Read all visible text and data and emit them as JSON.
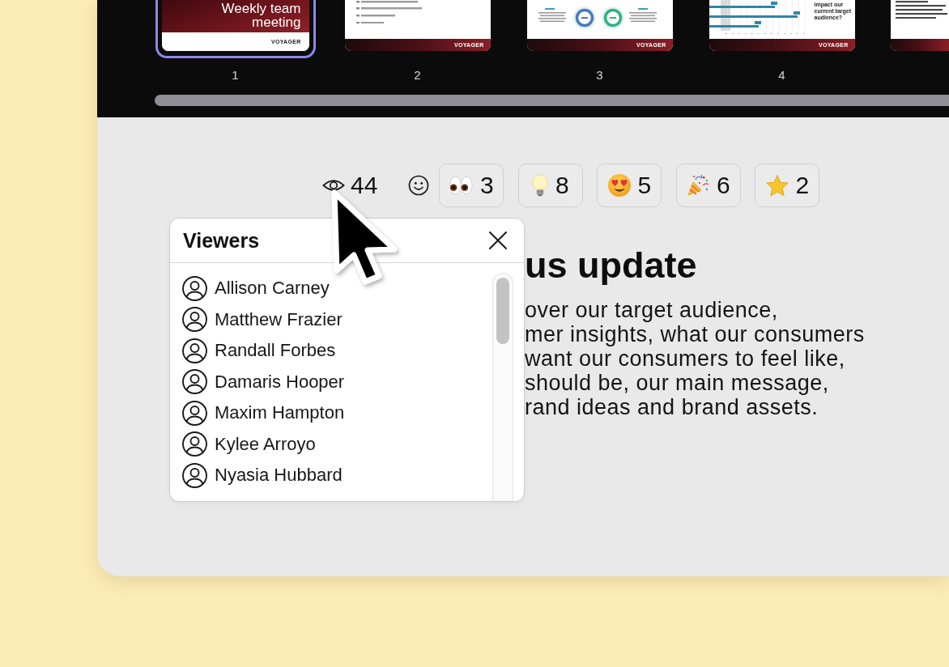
{
  "filmstrip": {
    "slides": [
      {
        "kind": "title",
        "title": "Weekly team meeting",
        "logo": "VOYAGER",
        "number": "1",
        "selected": true
      },
      {
        "kind": "agenda",
        "logo": "VOYAGER",
        "number": "2",
        "selected": false
      },
      {
        "kind": "donuts",
        "logo": "VOYAGER",
        "number": "3",
        "selected": false
      },
      {
        "kind": "bars",
        "question": "impact our current target audience?",
        "logo": "VOYAGER",
        "number": "4",
        "selected": false
      },
      {
        "kind": "text",
        "selected": false
      }
    ]
  },
  "reaction_bar": {
    "views": "44",
    "reactions": [
      {
        "kind": "eyes",
        "count": "3"
      },
      {
        "kind": "light_bulb",
        "count": "8"
      },
      {
        "kind": "heart_eyes",
        "count": "5"
      },
      {
        "kind": "party_popper",
        "count": "6"
      },
      {
        "kind": "star",
        "count": "2"
      }
    ]
  },
  "viewers_popup": {
    "title": "Viewers",
    "viewers": [
      "Allison Carney",
      "Matthew Frazier",
      "Randall Forbes",
      "Damaris Hooper",
      "Maxim Hampton",
      "Kylee Arroyo",
      "Nyasia Hubbard"
    ]
  },
  "slide_content": {
    "heading": "us update",
    "body_lines": [
      "over our target audience,",
      "mer insights, what our consumers",
      "want our consumers to feel like,",
      "should be, our main message,",
      "rand ideas and brand assets."
    ]
  }
}
